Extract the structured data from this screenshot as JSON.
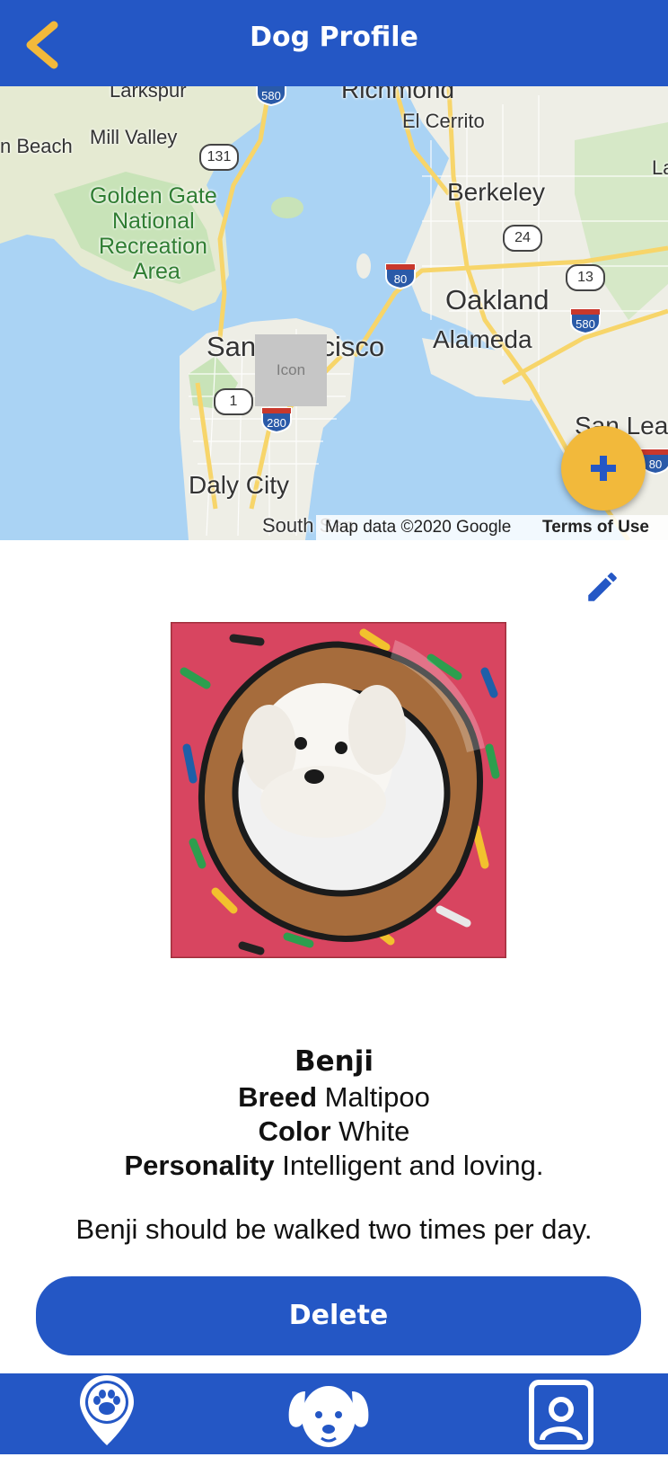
{
  "header": {
    "title": "Dog Profile",
    "back_icon": "chevron-left-icon",
    "back_color": "#f2b93b",
    "background": "#2457c5"
  },
  "map": {
    "labels": {
      "larkspur": "Larkspur",
      "richmond": "Richmond",
      "el_cerrito": "El Cerrito",
      "mill_valley": "Mill Valley",
      "beach": "n Beach",
      "golden_gate": "Golden Gate",
      "national": "National",
      "recreation": "Recreation",
      "area": "Area",
      "berkeley": "Berkeley",
      "oakland": "Oakland",
      "alameda": "Alameda",
      "san_francisco": "San Francisco",
      "daly_city": "Daly City",
      "south_san": "South San",
      "la": "La",
      "san_leandro": "San Lean"
    },
    "shields": {
      "i580_top": "580",
      "r131": "131",
      "r24": "24",
      "i80": "80",
      "r13": "13",
      "i580_right": "580",
      "r1": "1",
      "i280": "280",
      "i880": "80"
    },
    "placeholder_icon": "Icon",
    "google_logo": "Google",
    "attribution": "Map data ©2020 Google",
    "terms": "Terms of Use"
  },
  "fab": {
    "icon": "plus-icon",
    "color": "#f2b93b"
  },
  "edit": {
    "icon": "pencil-icon"
  },
  "dog": {
    "name": "Benji",
    "breed_label": "Breed",
    "breed": "Maltipoo",
    "color_label": "Color",
    "color": "White",
    "personality_label": "Personality",
    "personality": "Intelligent and loving.",
    "walk_note": "Benji should be walked two times per day."
  },
  "actions": {
    "delete_label": "Delete"
  },
  "bottom_nav": {
    "items": [
      {
        "icon": "paw-location-icon"
      },
      {
        "icon": "dog-face-icon"
      },
      {
        "icon": "profile-icon"
      }
    ]
  }
}
